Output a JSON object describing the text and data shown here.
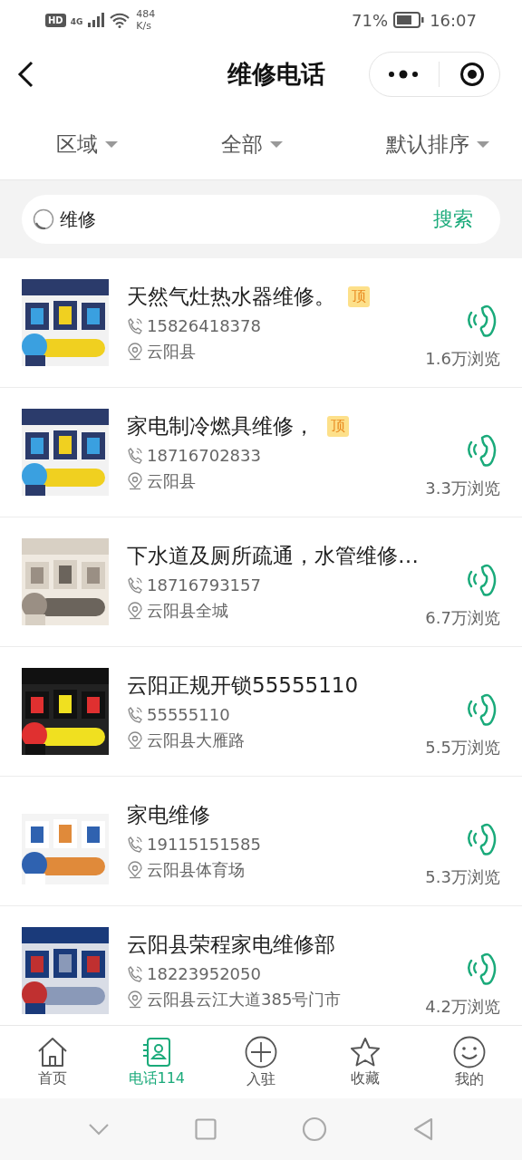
{
  "status_bar": {
    "hd": "HD",
    "network": "4G",
    "speed": [
      "484",
      "K/s"
    ],
    "battery": "71%",
    "time": "16:07"
  },
  "header": {
    "title": "维修电话"
  },
  "filters": [
    {
      "label": "区域"
    },
    {
      "label": "全部"
    },
    {
      "label": "默认排序"
    }
  ],
  "search": {
    "value": "维修",
    "button": "搜索"
  },
  "listings": [
    {
      "title": "天然气灶热水器维修。",
      "badge": "顶",
      "phone": "15826418378",
      "location": "云阳县",
      "views": "1.6万浏览"
    },
    {
      "title": "家电制冷燃具维修，",
      "badge": "顶",
      "phone": "18716702833",
      "location": "云阳县",
      "views": "3.3万浏览"
    },
    {
      "title": "下水道及厕所疏通，水管维修…",
      "phone": "18716793157",
      "location": "云阳县全城",
      "views": "6.7万浏览"
    },
    {
      "title": "云阳正规开锁55555110",
      "phone": "55555110",
      "location": "云阳县大雁路",
      "views": "5.5万浏览"
    },
    {
      "title": "家电维修",
      "phone": "19115151585",
      "location": "云阳县体育场",
      "views": "5.3万浏览"
    },
    {
      "title": "云阳县荣程家电维修部",
      "phone": "18223952050",
      "location": "云阳县云江大道385号门市",
      "views": "4.2万浏览"
    }
  ],
  "tab_bar": [
    {
      "label": "首页",
      "selected": false
    },
    {
      "label": "电话114",
      "selected": true
    },
    {
      "label": "入驻",
      "selected": false
    },
    {
      "label": "收藏",
      "selected": false
    },
    {
      "label": "我的",
      "selected": false
    }
  ]
}
